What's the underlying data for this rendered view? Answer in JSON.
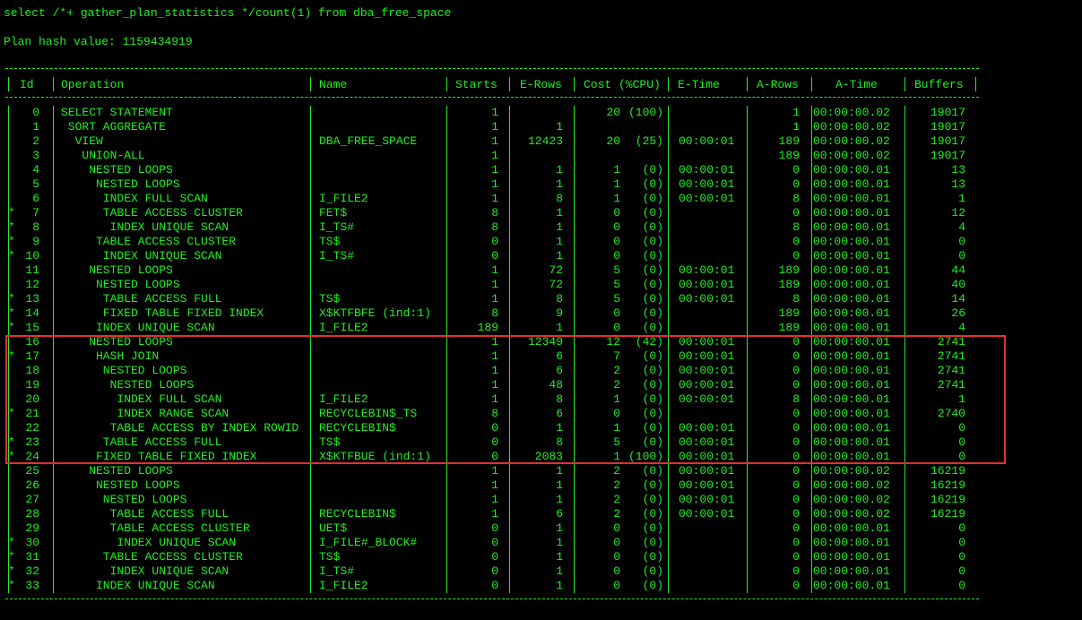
{
  "query": "select /*+ gather_plan_statistics */count(1) from dba_free_space",
  "plan_hash": "Plan hash value: 1159434919",
  "headers": {
    "id": "Id",
    "operation": "Operation",
    "name": "Name",
    "starts": "Starts",
    "erows": "E-Rows",
    "cost": "Cost (%CPU)",
    "etime": "E-Time",
    "arows": "A-Rows",
    "atime": "A-Time",
    "buffers": "Buffers"
  },
  "rows": [
    {
      "star": "",
      "id": "0",
      "op": "SELECT STATEMENT",
      "depth": 0,
      "name": "",
      "starts": "1",
      "erows": "",
      "cost": "20",
      "cpu": "(100)",
      "etime": "",
      "arows": "1",
      "atime": "00:00:00.02",
      "buffers": "19017"
    },
    {
      "star": "",
      "id": "1",
      "op": "SORT AGGREGATE",
      "depth": 1,
      "name": "",
      "starts": "1",
      "erows": "1",
      "cost": "",
      "cpu": "",
      "etime": "",
      "arows": "1",
      "atime": "00:00:00.02",
      "buffers": "19017"
    },
    {
      "star": "",
      "id": "2",
      "op": "VIEW",
      "depth": 2,
      "name": "DBA_FREE_SPACE",
      "starts": "1",
      "erows": "12423",
      "cost": "20",
      "cpu": "(25)",
      "etime": "00:00:01",
      "arows": "189",
      "atime": "00:00:00.02",
      "buffers": "19017"
    },
    {
      "star": "",
      "id": "3",
      "op": "UNION-ALL",
      "depth": 3,
      "name": "",
      "starts": "1",
      "erows": "",
      "cost": "",
      "cpu": "",
      "etime": "",
      "arows": "189",
      "atime": "00:00:00.02",
      "buffers": "19017"
    },
    {
      "star": "",
      "id": "4",
      "op": "NESTED LOOPS",
      "depth": 4,
      "name": "",
      "starts": "1",
      "erows": "1",
      "cost": "1",
      "cpu": "(0)",
      "etime": "00:00:01",
      "arows": "0",
      "atime": "00:00:00.01",
      "buffers": "13"
    },
    {
      "star": "",
      "id": "5",
      "op": "NESTED LOOPS",
      "depth": 5,
      "name": "",
      "starts": "1",
      "erows": "1",
      "cost": "1",
      "cpu": "(0)",
      "etime": "00:00:01",
      "arows": "0",
      "atime": "00:00:00.01",
      "buffers": "13"
    },
    {
      "star": "",
      "id": "6",
      "op": "INDEX FULL SCAN",
      "depth": 6,
      "name": "I_FILE2",
      "starts": "1",
      "erows": "8",
      "cost": "1",
      "cpu": "(0)",
      "etime": "00:00:01",
      "arows": "8",
      "atime": "00:00:00.01",
      "buffers": "1"
    },
    {
      "star": "*",
      "id": "7",
      "op": "TABLE ACCESS CLUSTER",
      "depth": 6,
      "name": "FET$",
      "starts": "8",
      "erows": "1",
      "cost": "0",
      "cpu": "(0)",
      "etime": "",
      "arows": "0",
      "atime": "00:00:00.01",
      "buffers": "12"
    },
    {
      "star": "*",
      "id": "8",
      "op": "INDEX UNIQUE SCAN",
      "depth": 7,
      "name": "I_TS#",
      "starts": "8",
      "erows": "1",
      "cost": "0",
      "cpu": "(0)",
      "etime": "",
      "arows": "8",
      "atime": "00:00:00.01",
      "buffers": "4"
    },
    {
      "star": "*",
      "id": "9",
      "op": "TABLE ACCESS CLUSTER",
      "depth": 5,
      "name": "TS$",
      "starts": "0",
      "erows": "1",
      "cost": "0",
      "cpu": "(0)",
      "etime": "",
      "arows": "0",
      "atime": "00:00:00.01",
      "buffers": "0"
    },
    {
      "star": "*",
      "id": "10",
      "op": "INDEX UNIQUE SCAN",
      "depth": 6,
      "name": "I_TS#",
      "starts": "0",
      "erows": "1",
      "cost": "0",
      "cpu": "(0)",
      "etime": "",
      "arows": "0",
      "atime": "00:00:00.01",
      "buffers": "0"
    },
    {
      "star": "",
      "id": "11",
      "op": "NESTED LOOPS",
      "depth": 4,
      "name": "",
      "starts": "1",
      "erows": "72",
      "cost": "5",
      "cpu": "(0)",
      "etime": "00:00:01",
      "arows": "189",
      "atime": "00:00:00.01",
      "buffers": "44"
    },
    {
      "star": "",
      "id": "12",
      "op": "NESTED LOOPS",
      "depth": 5,
      "name": "",
      "starts": "1",
      "erows": "72",
      "cost": "5",
      "cpu": "(0)",
      "etime": "00:00:01",
      "arows": "189",
      "atime": "00:00:00.01",
      "buffers": "40"
    },
    {
      "star": "*",
      "id": "13",
      "op": "TABLE ACCESS FULL",
      "depth": 6,
      "name": "TS$",
      "starts": "1",
      "erows": "8",
      "cost": "5",
      "cpu": "(0)",
      "etime": "00:00:01",
      "arows": "8",
      "atime": "00:00:00.01",
      "buffers": "14"
    },
    {
      "star": "*",
      "id": "14",
      "op": "FIXED TABLE FIXED INDEX",
      "depth": 6,
      "name": "X$KTFBFE (ind:1)",
      "starts": "8",
      "erows": "9",
      "cost": "0",
      "cpu": "(0)",
      "etime": "",
      "arows": "189",
      "atime": "00:00:00.01",
      "buffers": "26"
    },
    {
      "star": "*",
      "id": "15",
      "op": "INDEX UNIQUE SCAN",
      "depth": 5,
      "name": "I_FILE2",
      "starts": "189",
      "erows": "1",
      "cost": "0",
      "cpu": "(0)",
      "etime": "",
      "arows": "189",
      "atime": "00:00:00.01",
      "buffers": "4"
    },
    {
      "star": "",
      "id": "16",
      "op": "NESTED LOOPS",
      "depth": 4,
      "name": "",
      "starts": "1",
      "erows": "12349",
      "cost": "12",
      "cpu": "(42)",
      "etime": "00:00:01",
      "arows": "0",
      "atime": "00:00:00.01",
      "buffers": "2741"
    },
    {
      "star": "*",
      "id": "17",
      "op": "HASH JOIN",
      "depth": 5,
      "name": "",
      "starts": "1",
      "erows": "6",
      "cost": "7",
      "cpu": "(0)",
      "etime": "00:00:01",
      "arows": "0",
      "atime": "00:00:00.01",
      "buffers": "2741"
    },
    {
      "star": "",
      "id": "18",
      "op": "NESTED LOOPS",
      "depth": 6,
      "name": "",
      "starts": "1",
      "erows": "6",
      "cost": "2",
      "cpu": "(0)",
      "etime": "00:00:01",
      "arows": "0",
      "atime": "00:00:00.01",
      "buffers": "2741"
    },
    {
      "star": "",
      "id": "19",
      "op": "NESTED LOOPS",
      "depth": 7,
      "name": "",
      "starts": "1",
      "erows": "48",
      "cost": "2",
      "cpu": "(0)",
      "etime": "00:00:01",
      "arows": "0",
      "atime": "00:00:00.01",
      "buffers": "2741"
    },
    {
      "star": "",
      "id": "20",
      "op": "INDEX FULL SCAN",
      "depth": 8,
      "name": "I_FILE2",
      "starts": "1",
      "erows": "8",
      "cost": "1",
      "cpu": "(0)",
      "etime": "00:00:01",
      "arows": "8",
      "atime": "00:00:00.01",
      "buffers": "1"
    },
    {
      "star": "*",
      "id": "21",
      "op": "INDEX RANGE SCAN",
      "depth": 8,
      "name": "RECYCLEBIN$_TS",
      "starts": "8",
      "erows": "6",
      "cost": "0",
      "cpu": "(0)",
      "etime": "",
      "arows": "0",
      "atime": "00:00:00.01",
      "buffers": "2740"
    },
    {
      "star": "",
      "id": "22",
      "op": "TABLE ACCESS BY INDEX ROWID",
      "depth": 7,
      "name": "RECYCLEBIN$",
      "starts": "0",
      "erows": "1",
      "cost": "1",
      "cpu": "(0)",
      "etime": "00:00:01",
      "arows": "0",
      "atime": "00:00:00.01",
      "buffers": "0"
    },
    {
      "star": "*",
      "id": "23",
      "op": "TABLE ACCESS FULL",
      "depth": 6,
      "name": "TS$",
      "starts": "0",
      "erows": "8",
      "cost": "5",
      "cpu": "(0)",
      "etime": "00:00:01",
      "arows": "0",
      "atime": "00:00:00.01",
      "buffers": "0"
    },
    {
      "star": "*",
      "id": "24",
      "op": "FIXED TABLE FIXED INDEX",
      "depth": 5,
      "name": "X$KTFBUE (ind:1)",
      "starts": "0",
      "erows": "2083",
      "cost": "1",
      "cpu": "(100)",
      "etime": "00:00:01",
      "arows": "0",
      "atime": "00:00:00.01",
      "buffers": "0"
    },
    {
      "star": "",
      "id": "25",
      "op": "NESTED LOOPS",
      "depth": 4,
      "name": "",
      "starts": "1",
      "erows": "1",
      "cost": "2",
      "cpu": "(0)",
      "etime": "00:00:01",
      "arows": "0",
      "atime": "00:00:00.02",
      "buffers": "16219"
    },
    {
      "star": "",
      "id": "26",
      "op": "NESTED LOOPS",
      "depth": 5,
      "name": "",
      "starts": "1",
      "erows": "1",
      "cost": "2",
      "cpu": "(0)",
      "etime": "00:00:01",
      "arows": "0",
      "atime": "00:00:00.02",
      "buffers": "16219"
    },
    {
      "star": "",
      "id": "27",
      "op": "NESTED LOOPS",
      "depth": 6,
      "name": "",
      "starts": "1",
      "erows": "1",
      "cost": "2",
      "cpu": "(0)",
      "etime": "00:00:01",
      "arows": "0",
      "atime": "00:00:00.02",
      "buffers": "16219"
    },
    {
      "star": "",
      "id": "28",
      "op": "TABLE ACCESS FULL",
      "depth": 7,
      "name": "RECYCLEBIN$",
      "starts": "1",
      "erows": "6",
      "cost": "2",
      "cpu": "(0)",
      "etime": "00:00:01",
      "arows": "0",
      "atime": "00:00:00.02",
      "buffers": "16219"
    },
    {
      "star": "",
      "id": "29",
      "op": "TABLE ACCESS CLUSTER",
      "depth": 7,
      "name": "UET$",
      "starts": "0",
      "erows": "1",
      "cost": "0",
      "cpu": "(0)",
      "etime": "",
      "arows": "0",
      "atime": "00:00:00.01",
      "buffers": "0"
    },
    {
      "star": "*",
      "id": "30",
      "op": "INDEX UNIQUE SCAN",
      "depth": 8,
      "name": "I_FILE#_BLOCK#",
      "starts": "0",
      "erows": "1",
      "cost": "0",
      "cpu": "(0)",
      "etime": "",
      "arows": "0",
      "atime": "00:00:00.01",
      "buffers": "0"
    },
    {
      "star": "*",
      "id": "31",
      "op": "TABLE ACCESS CLUSTER",
      "depth": 6,
      "name": "TS$",
      "starts": "0",
      "erows": "1",
      "cost": "0",
      "cpu": "(0)",
      "etime": "",
      "arows": "0",
      "atime": "00:00:00.01",
      "buffers": "0"
    },
    {
      "star": "*",
      "id": "32",
      "op": "INDEX UNIQUE SCAN",
      "depth": 7,
      "name": "I_TS#",
      "starts": "0",
      "erows": "1",
      "cost": "0",
      "cpu": "(0)",
      "etime": "",
      "arows": "0",
      "atime": "00:00:00.01",
      "buffers": "0"
    },
    {
      "star": "*",
      "id": "33",
      "op": "INDEX UNIQUE SCAN",
      "depth": 5,
      "name": "I_FILE2",
      "starts": "0",
      "erows": "1",
      "cost": "0",
      "cpu": "(0)",
      "etime": "",
      "arows": "0",
      "atime": "00:00:00.01",
      "buffers": "0"
    }
  ],
  "highlight_rows": [
    "16",
    "17",
    "18",
    "19",
    "20",
    "21",
    "22",
    "23",
    "24"
  ],
  "colors": {
    "text": "#22ee22",
    "background": "#000000",
    "highlight_box": "#e53030"
  }
}
